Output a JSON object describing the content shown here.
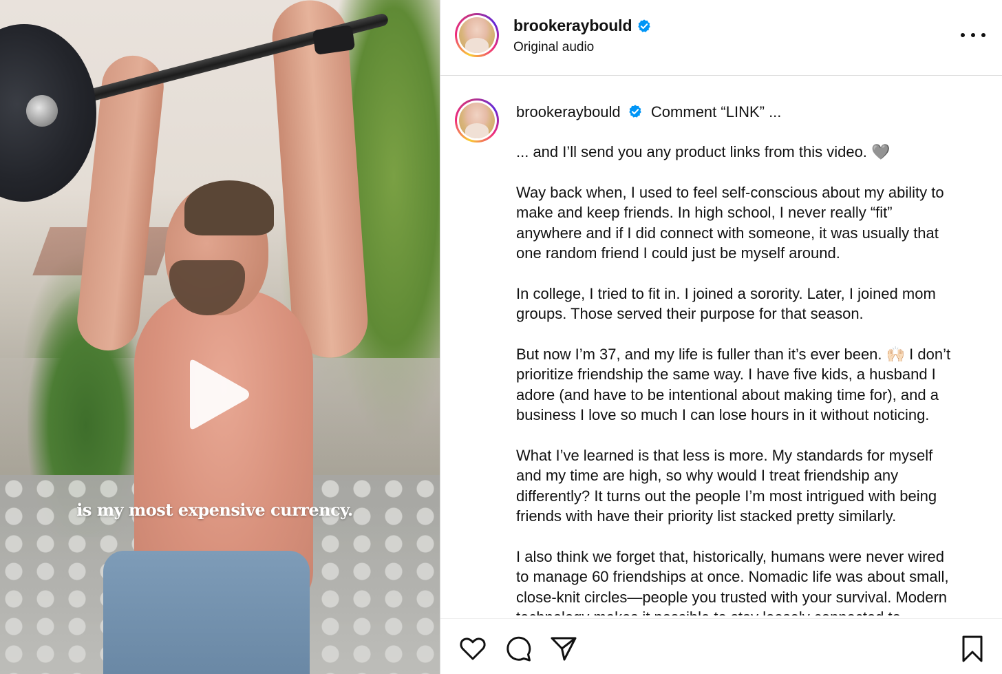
{
  "video": {
    "caption": "is my most expensive currency.",
    "play_icon": "play-icon"
  },
  "header": {
    "username": "brookeraybould",
    "verified_icon": "verified-badge-icon",
    "audio": "Original audio",
    "more_icon": "more-options-icon"
  },
  "post": {
    "username": "brookeraybould",
    "headline": "Comment “LINK” ...",
    "paragraphs": [
      [
        "... and I’ll send you any product links from this video. 🩶"
      ],
      [
        "Way back when, I used to feel self-conscious about my ability to",
        "make and keep friends. In high school, I never really “fit”",
        "anywhere and if I did connect with someone, it was usually that",
        "one random friend I could just be myself around."
      ],
      [
        "In college, I tried to fit in. I joined a sorority. Later, I joined mom",
        "groups. Those served their purpose for that season."
      ],
      [
        "But now I’m 37, and my life is fuller than it’s ever been. 🙌🏻 I don’t",
        "prioritize friendship the same way. I have five kids, a husband I",
        "adore (and have to be intentional about making time for), and a",
        "business I love so much I can lose hours in it without noticing."
      ],
      [
        "What I’ve learned is that less is more. My standards for myself",
        "and my time are high, so why would I treat friendship any",
        "differently? It turns out the people I’m most intrigued with being",
        "friends with have their priority list stacked pretty similarly."
      ],
      [
        "I also think we forget that, historically, humans were never wired",
        "to manage 60 friendships at once. Nomadic life was about small,",
        "close-knit circles—people you trusted with your survival. Modern",
        "technology makes it possible to stay loosely connected to"
      ]
    ]
  },
  "actions": {
    "like_icon": "heart-icon",
    "comment_icon": "comment-icon",
    "share_icon": "share-icon",
    "save_icon": "bookmark-icon"
  },
  "colors": {
    "verified": "#0095f6",
    "text": "#111111",
    "divider": "#dbdbdb"
  }
}
